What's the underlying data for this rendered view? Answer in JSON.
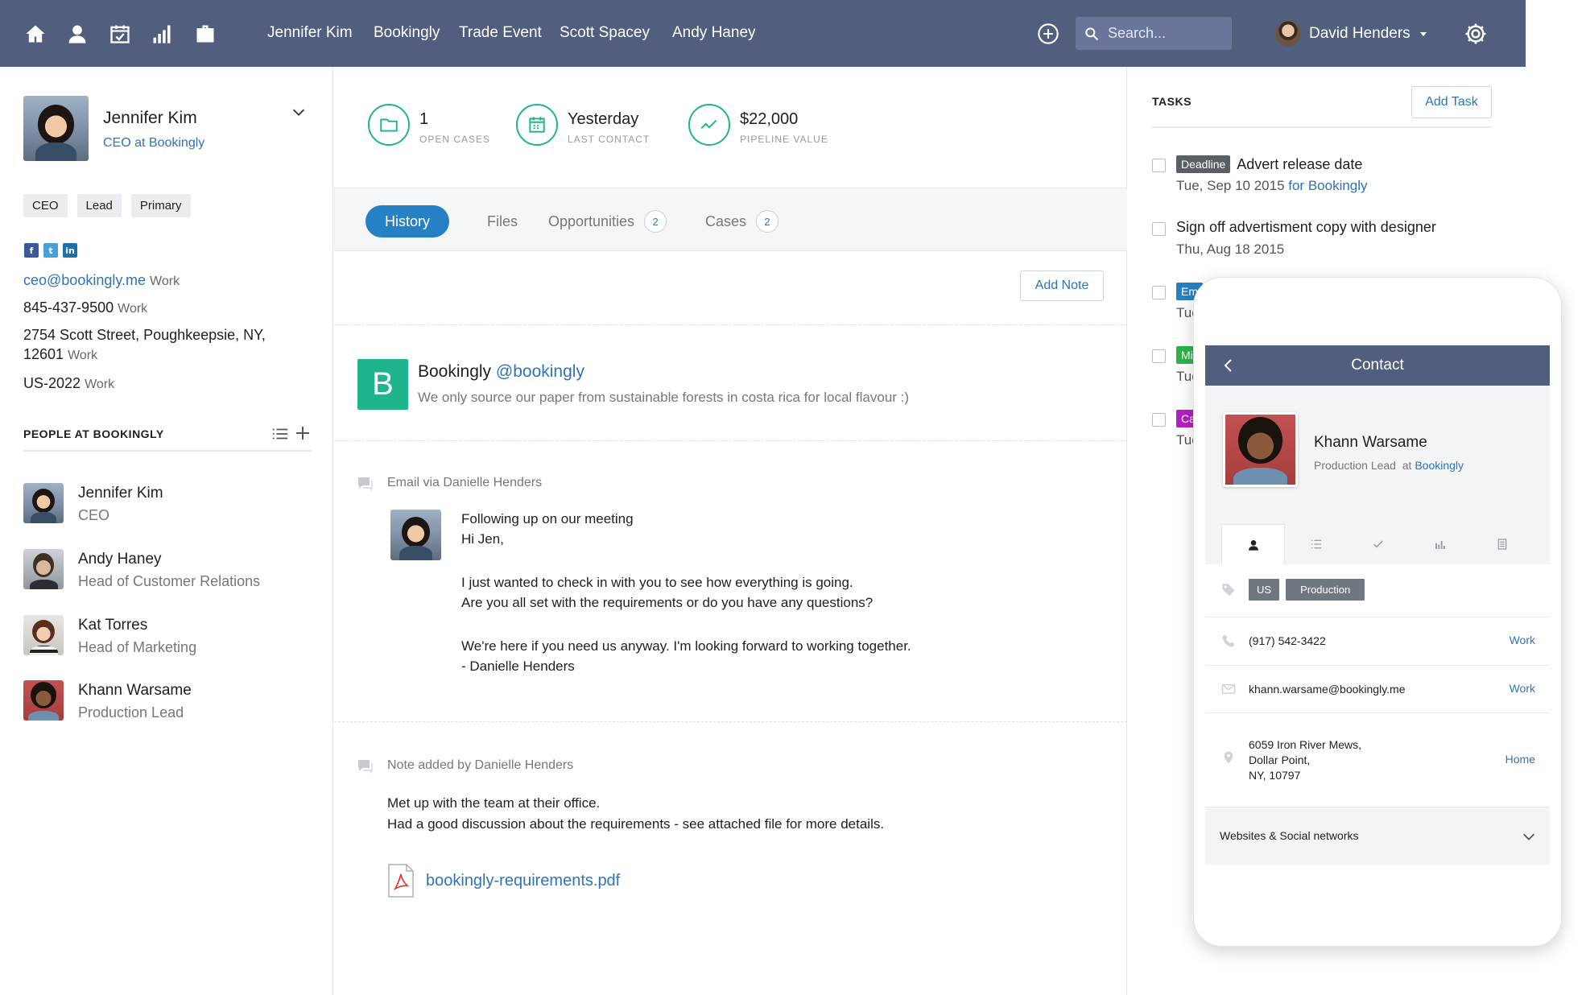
{
  "colors": {
    "nav_bg": "#515e7d",
    "accent": "#2f73b8",
    "green": "#1fb58c",
    "tab_active": "#2581c4"
  },
  "nav": {
    "icons": [
      "home-icon",
      "person-icon",
      "calendar-icon",
      "bar-chart-icon",
      "briefcase-icon"
    ],
    "links": [
      "Jennifer Kim",
      "Bookingly",
      "Trade Event",
      "Scott Spacey",
      "Andy Haney"
    ],
    "search_placeholder": "Search...",
    "user_name": "David Henders"
  },
  "profile": {
    "name": "Jennifer Kim",
    "role_prefix": "CEO at ",
    "company": "Bookingly",
    "tags": [
      "CEO",
      "Lead",
      "Primary"
    ],
    "socials": [
      "f",
      "t",
      "in"
    ],
    "email": "ceo@bookingly.me",
    "email_kind": "Work",
    "phone": "845-437-9500",
    "phone_kind": "Work",
    "address_line1": "2754 Scott Street, Poughkeepsie, NY,",
    "address_line2": "12601",
    "address_kind": "Work",
    "other": "US-2022",
    "other_kind": "Work"
  },
  "people": {
    "title": "PEOPLE AT BOOKINGLY",
    "items": [
      {
        "name": "Jennifer Kim",
        "title": "CEO"
      },
      {
        "name": "Andy Haney",
        "title": "Head of Customer Relations"
      },
      {
        "name": "Kat Torres",
        "title": "Head of Marketing"
      },
      {
        "name": "Khann Warsame",
        "title": "Production Lead"
      }
    ]
  },
  "stats": [
    {
      "value": "1",
      "label": "OPEN CASES"
    },
    {
      "value": "Yesterday",
      "label": "LAST CONTACT"
    },
    {
      "value": "$22,000",
      "label": "PIPELINE VALUE"
    }
  ],
  "tabs": [
    {
      "label": "History"
    },
    {
      "label": "Files"
    },
    {
      "label": "Opportunities",
      "count": "2"
    },
    {
      "label": "Cases",
      "count": "2"
    }
  ],
  "add_note_label": "Add Note",
  "tweet": {
    "logo_letter": "B",
    "name": "Bookingly",
    "handle": "@bookingly",
    "text": "We only source our paper from sustainable forests in costa rica for local flavour :)"
  },
  "email": {
    "meta": "Email via Danielle Henders",
    "subject": "Following up on our meeting",
    "lines": [
      "Hi Jen,",
      "I just wanted to check in with you to see how everything is going.",
      "Are you all set with the requirements or do you have any questions?",
      "We're here if you need us anyway. I'm looking forward to working together.",
      "- Danielle Henders"
    ]
  },
  "note": {
    "meta": "Note added by Danielle Henders",
    "lines": [
      "Met up with the team at their office.",
      "Had a good discussion about the requirements - see attached file for more details."
    ],
    "attachment": "bookingly-requirements.pdf"
  },
  "tasks": {
    "title": "TASKS",
    "add_label": "Add Task",
    "items": [
      {
        "pill": "Deadline",
        "pill_color": "#5a5f66",
        "title": "Advert release date",
        "date": "Tue, Sep 10 2015",
        "for_text": " for ",
        "for_link": "Bookingly"
      },
      {
        "pill": "",
        "title": "Sign off advertisment copy with designer",
        "date": "Thu, Aug 18 2015"
      },
      {
        "pill": "Em",
        "pill_color": "#2581c4",
        "title": "",
        "date": "Tue"
      },
      {
        "pill": "Mi",
        "pill_color": "#2cb34a",
        "title": "",
        "date": "Tue"
      },
      {
        "pill": "Ca",
        "pill_color": "#b51fc2",
        "title": "",
        "date": "Tue"
      }
    ]
  },
  "mobile": {
    "header": "Contact",
    "name": "Khann Warsame",
    "role": "Production Lead",
    "at": "  at ",
    "company": "Bookingly",
    "tags": [
      "US",
      "Production"
    ],
    "phone": "(917) 542-3422",
    "phone_kind": "Work",
    "email": "khann.warsame@bookingly.me",
    "email_kind": "Work",
    "address": [
      "6059 Iron River Mews,",
      "Dollar Point,",
      "NY, 10797"
    ],
    "address_kind": "Home",
    "websites": "Websites & Social networks"
  }
}
